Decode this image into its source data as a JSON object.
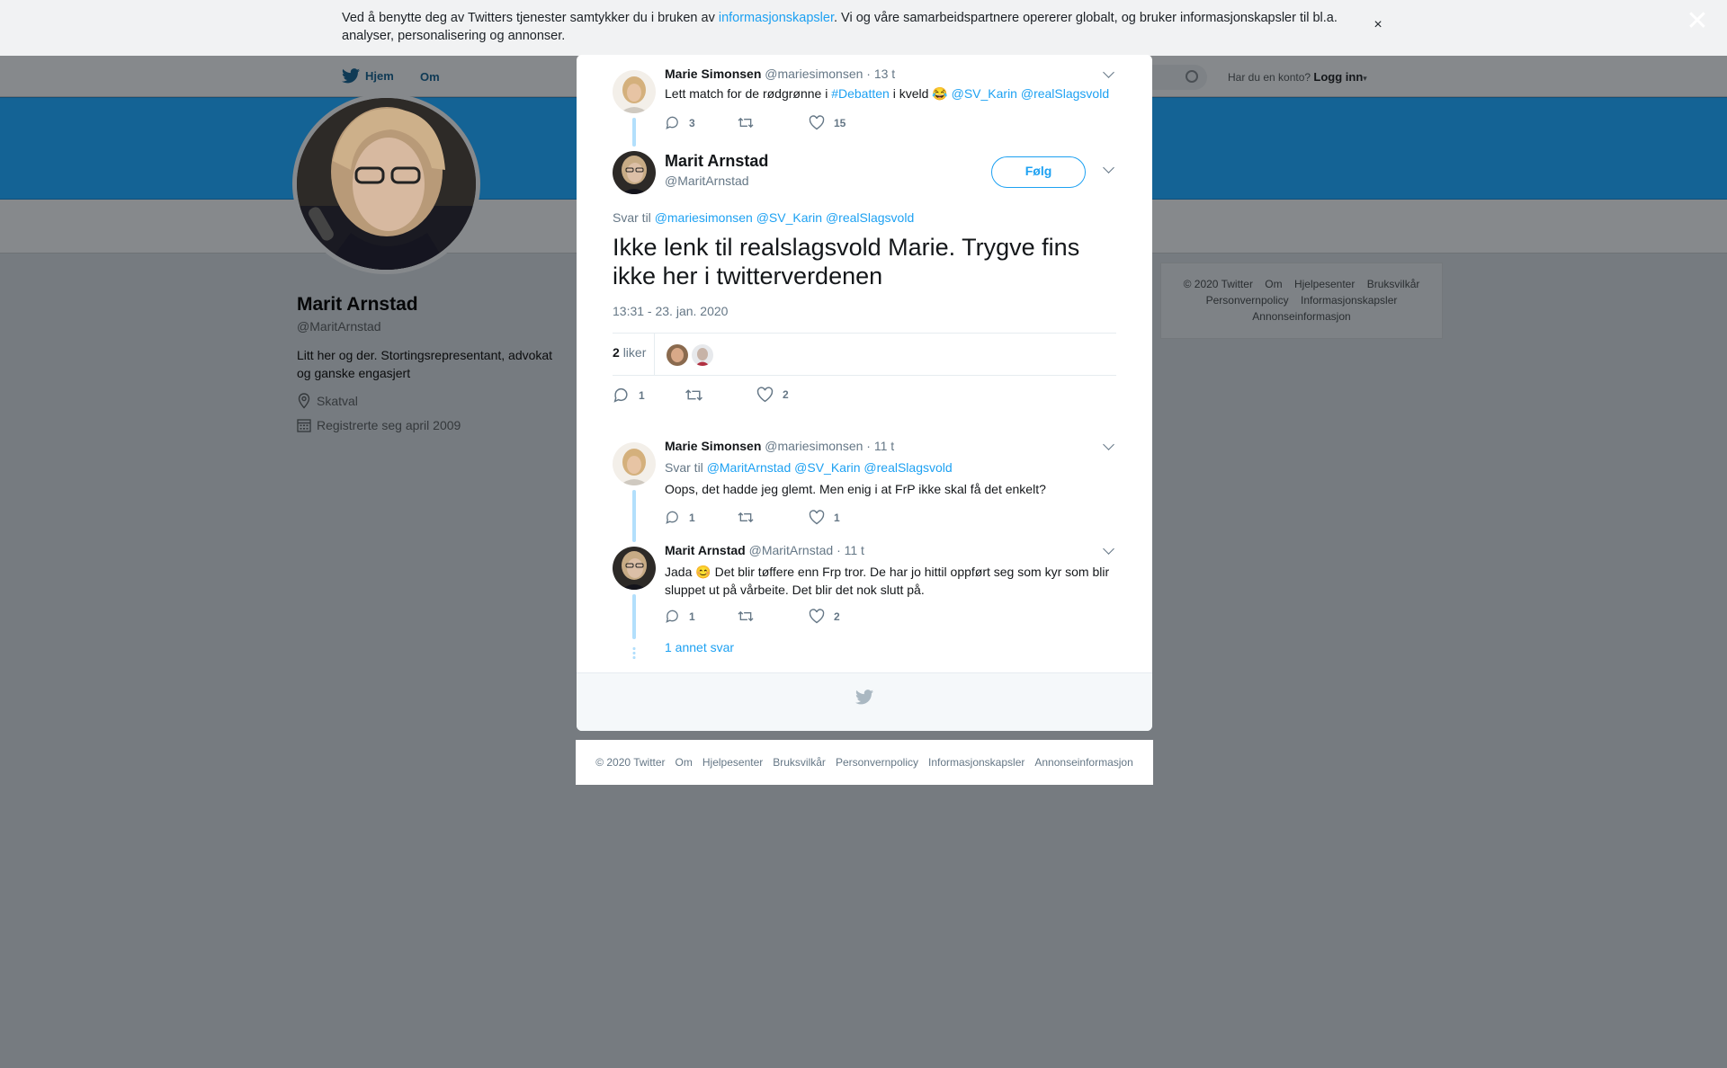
{
  "cookie": {
    "text_before": "Ved å benytte deg av Twitters tjenester samtykker du i bruken av ",
    "link": "informasjonskapsler",
    "text_after": ". Vi og våre samarbeidspartnere opererer globalt, og bruker informasjonskapsler til bl.a. analyser, personalisering og annonser.",
    "close_glyph": "×"
  },
  "page_close_glyph": "✕",
  "topnav": {
    "home": "Hjem",
    "about": "Om",
    "have_account": "Har du en konto?",
    "login": "Logg inn"
  },
  "profile": {
    "name": "Marit Arnstad",
    "handle": "@MaritArnstad",
    "bio": "Litt her og der. Stortingsrepresentant, advokat og ganske engasjert",
    "location": "Skatval",
    "joined": "Registrerte seg april 2009"
  },
  "side_footer": [
    "© 2020 Twitter",
    "Om",
    "Hjelpesenter",
    "Bruksvilkår",
    "Personvernpolicy",
    "Informasjonskapsler",
    "Annonseinformasjon"
  ],
  "modal": {
    "parent_tweet": {
      "name": "Marie Simonsen",
      "handle": "@mariesimonsen",
      "time": "· 13 t",
      "text_before": "Lett match for de rødgrønne i ",
      "hashtag": "#Debatten",
      "text_mid": " i kveld ",
      "emoji": "😂",
      "mention1": "@SV_Karin",
      "mention2": "@realSlagsvold",
      "replies": "3",
      "retweets": "",
      "likes": "15"
    },
    "main_tweet": {
      "name": "Marit Arnstad",
      "handle": "@MaritArnstad",
      "follow": "Følg",
      "reply_to_label": "Svar til",
      "reply_to": [
        "@mariesimonsen",
        "@SV_Karin",
        "@realSlagsvold"
      ],
      "text": "Ikke lenk til realslagsvold Marie. Trygve fins ikke her i twitterverdenen",
      "timestamp": "13:31 - 23. jan. 2020",
      "likes_count": "2",
      "likes_label": "liker",
      "replies": "1",
      "retweets": "",
      "likes": "2"
    },
    "reply1": {
      "name": "Marie Simonsen",
      "handle": "@mariesimonsen",
      "time": "· 11 t",
      "reply_to_label": "Svar til",
      "reply_to": [
        "@MaritArnstad",
        "@SV_Karin",
        "@realSlagsvold"
      ],
      "text": "Oops, det hadde jeg glemt. Men enig i at FrP ikke skal få det enkelt?",
      "replies": "1",
      "retweets": "",
      "likes": "1"
    },
    "reply2": {
      "name": "Marit Arnstad",
      "handle": "@MaritArnstad",
      "time": "· 11 t",
      "text_before": "Jada ",
      "emoji": "😊",
      "text_after": " Det blir tøffere enn Frp tror. De har jo hittil oppført seg som kyr som blir sluppet ut på vårbeite. Det blir det nok slutt på.",
      "replies": "1",
      "retweets": "",
      "likes": "2"
    },
    "more_replies": "1 annet svar"
  },
  "bottom_footer": [
    "© 2020 Twitter",
    "Om",
    "Hjelpesenter",
    "Bruksvilkår",
    "Personvernpolicy",
    "Informasjonskapsler",
    "Annonseinformasjon"
  ],
  "colors": {
    "accent": "#1da1f2",
    "banner": "#146395",
    "overlay": "#767b80"
  }
}
